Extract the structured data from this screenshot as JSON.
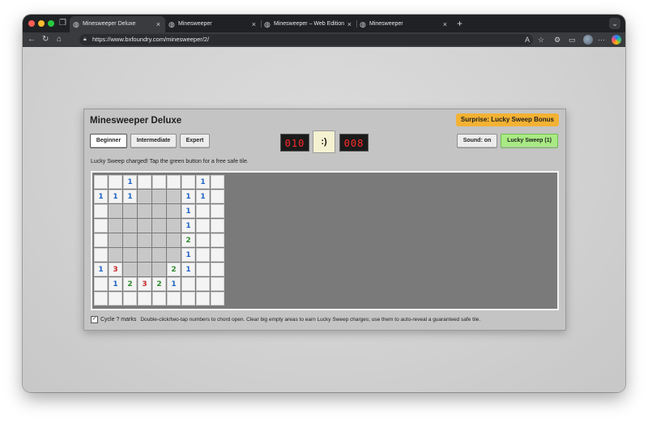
{
  "browser": {
    "tabs": [
      {
        "label": "Minesweeper Deluxe",
        "active": true
      },
      {
        "label": "Minesweeper",
        "active": false
      },
      {
        "label": "Minesweeper – Web Edition",
        "active": false
      },
      {
        "label": "Minesweeper",
        "active": false
      }
    ],
    "url": "https://www.bxfoundry.com/minesweeper/2/",
    "icons": [
      "back-icon",
      "reload-icon",
      "home-icon",
      "lock-icon",
      "read-aloud-icon",
      "favorite-icon",
      "extensions-icon",
      "split-screen-icon",
      "more-icon"
    ]
  },
  "game": {
    "title": "Minesweeper Deluxe",
    "surprise": "Surprise: Lucky Sweep Bonus",
    "difficulty": {
      "beginner": "Beginner",
      "intermediate": "Intermediate",
      "expert": "Expert",
      "selected": "Beginner"
    },
    "mine_counter": "010",
    "face": ":)",
    "timer": "008",
    "sound_button": "Sound: on",
    "lucky_button": "Lucky Sweep (1)",
    "status": "Lucky Sweep charged! Tap the green button for a free safe tile.",
    "board": [
      [
        "c",
        "c",
        "1",
        "c",
        "c",
        "c",
        "c",
        "1",
        "c"
      ],
      [
        "1",
        "1",
        "1",
        "o",
        "o",
        "o",
        "1",
        "1",
        "c"
      ],
      [
        "c",
        "o",
        "o",
        "o",
        "o",
        "o",
        "1",
        "c",
        "c"
      ],
      [
        "c",
        "o",
        "o",
        "o",
        "o",
        "o",
        "1",
        "c",
        "c"
      ],
      [
        "c",
        "o",
        "o",
        "o",
        "o",
        "o",
        "2",
        "c",
        "c"
      ],
      [
        "c",
        "o",
        "o",
        "o",
        "o",
        "o",
        "1",
        "c",
        "c"
      ],
      [
        "1",
        "3",
        "o",
        "o",
        "o",
        "2",
        "1",
        "c",
        "c"
      ],
      [
        "c",
        "1",
        "2",
        "3",
        "2",
        "1",
        "c",
        "c",
        "c"
      ],
      [
        "c",
        "c",
        "c",
        "c",
        "c",
        "c",
        "c",
        "c",
        "c"
      ]
    ],
    "footer": {
      "checkbox_label": "Cycle ? marks",
      "checkbox_checked": true,
      "help": "Double-click/two-tap numbers to chord open. Clear big empty areas to earn Lucky Sweep charges; use them to auto-reveal a guaranteed safe tile."
    }
  }
}
